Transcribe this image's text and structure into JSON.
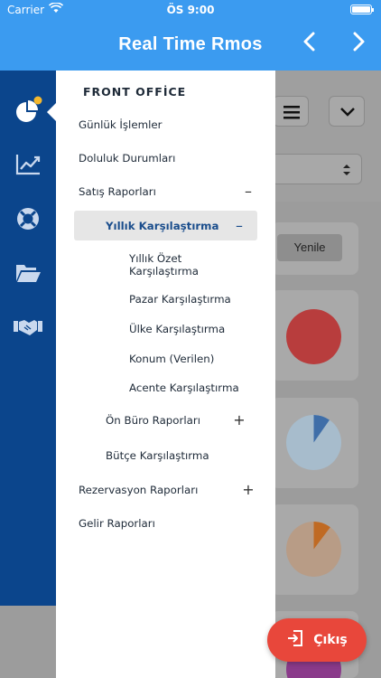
{
  "status_bar": {
    "carrier": "Carrier",
    "time": "ÖS 9:00"
  },
  "header": {
    "title": "Real Time Rmos",
    "prev_icon": "chevron-left-icon",
    "next_icon": "chevron-right-icon"
  },
  "rail": {
    "icons": [
      "pie-chart-icon",
      "line-chart-icon",
      "lifebuoy-icon",
      "folder-open-icon",
      "handshake-icon"
    ],
    "accent": "#f5b82e"
  },
  "menu": {
    "section_title": "FRONT OFFİCE",
    "items": [
      {
        "label": "Günlük İşlemler"
      },
      {
        "label": "Doluluk Durumları"
      },
      {
        "label": "Satış Raporları",
        "sign": "–"
      },
      {
        "label": "Yıllık Karşılaştırma",
        "sign": "–"
      },
      {
        "label": "Yıllık Özet Karşılaştırma"
      },
      {
        "label": "Pazar Karşılaştırma"
      },
      {
        "label": "Ülke Karşılaştırma"
      },
      {
        "label": "Konum (Verilen)"
      },
      {
        "label": "Acente Karşılaştırma"
      },
      {
        "label": "Ön Büro Raporları",
        "sign": "+"
      },
      {
        "label": "Bütçe Karşılaştırma"
      },
      {
        "label": "Rezervasyon Raporları",
        "sign": "+"
      },
      {
        "label": "Gelir Raporları"
      }
    ]
  },
  "background": {
    "refresh_label": "Yenile"
  },
  "exit_button": {
    "label": "Çıkış"
  },
  "colors": {
    "header": "#3b9bf0",
    "rail": "#0b458c",
    "exit": "#e8473b"
  }
}
